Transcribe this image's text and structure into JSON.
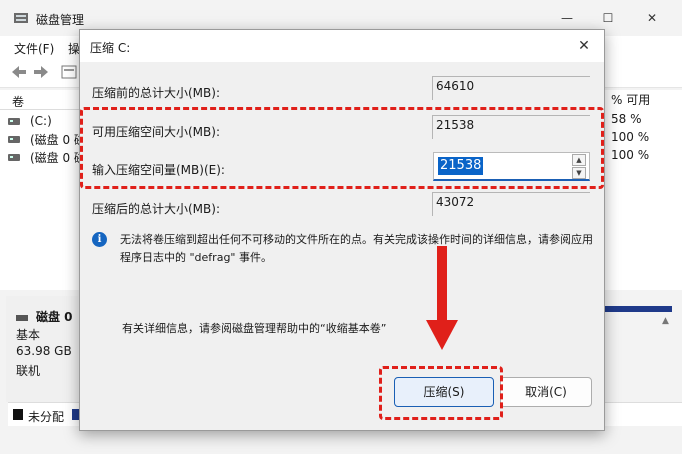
{
  "window": {
    "title": "磁盘管理",
    "controls": {
      "minimize": "—",
      "maximize": "☐",
      "close": "✕"
    }
  },
  "menu": {
    "file": "文件(F)",
    "action": "操"
  },
  "list": {
    "header_volume": "卷",
    "header_percent": "% 可用",
    "rows": [
      {
        "name": "(C:)",
        "percent": "58 %"
      },
      {
        "name": "(磁盘 0 磁",
        "percent": "100 %"
      },
      {
        "name": "(磁盘 0 磁",
        "percent": "100 %"
      }
    ]
  },
  "disk": {
    "name": "磁盘 0",
    "type": "基本",
    "size": "63.98 GB",
    "status": "联机"
  },
  "legend": {
    "unallocated": "未分配"
  },
  "dialog": {
    "title": "压缩 C:",
    "close": "✕",
    "fields": {
      "total_before_label": "压缩前的总计大小(MB):",
      "total_before_value": "64610",
      "available_label": "可用压缩空间大小(MB):",
      "available_value": "21538",
      "input_label": "输入压缩空间量(MB)(E):",
      "input_value": "21538",
      "total_after_label": "压缩后的总计大小(MB):",
      "total_after_value": "43072"
    },
    "info_text": "无法将卷压缩到超出任何不可移动的文件所在的点。有关完成该操作时间的详细信息，请参阅应用程序日志中的 \"defrag\" 事件。",
    "help_text": "有关详细信息，请参阅磁盘管理帮助中的“收缩基本卷”",
    "shrink_button": "压缩(S)",
    "cancel_button": "取消(C)"
  },
  "colors": {
    "highlight": "#e0201a",
    "accent": "#1a5fb4",
    "selection": "#0a64c8"
  }
}
